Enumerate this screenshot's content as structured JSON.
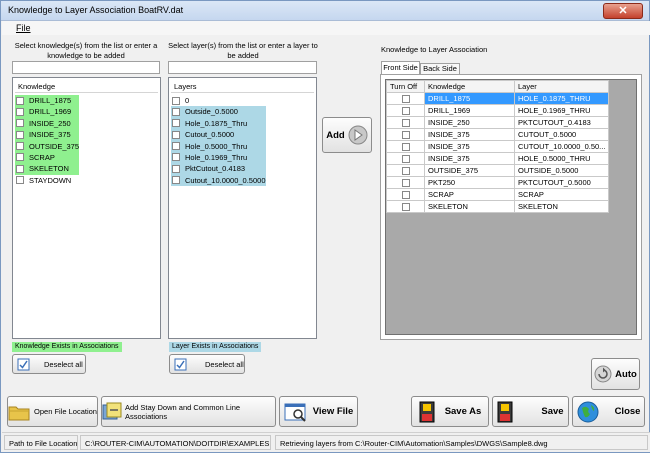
{
  "window": {
    "title": "Knowledge to Layer Association BoatRV.dat"
  },
  "menu": {
    "file": "File"
  },
  "knowledge": {
    "instruction": "Select knowledge(s) from the list or enter a knowledge to be added",
    "input_value": "",
    "header": "Knowledge",
    "items": [
      {
        "label": "DRILL_1875",
        "in_assoc": true
      },
      {
        "label": "DRILL_1969",
        "in_assoc": true
      },
      {
        "label": "INSIDE_250",
        "in_assoc": true
      },
      {
        "label": "INSIDE_375",
        "in_assoc": true
      },
      {
        "label": "OUTSIDE_375",
        "in_assoc": true
      },
      {
        "label": "SCRAP",
        "in_assoc": true
      },
      {
        "label": "SKELETON",
        "in_assoc": true
      },
      {
        "label": "STAYDOWN",
        "in_assoc": false
      }
    ],
    "legend": "Knowledge Exists in Associations",
    "deselect": "Deselect all"
  },
  "layers": {
    "instruction": "Select layer(s) from the list or enter a layer to be added",
    "input_value": "",
    "header": "Layers",
    "items": [
      {
        "label": "0",
        "in_assoc": false
      },
      {
        "label": "Outside_0.5000",
        "in_assoc": true
      },
      {
        "label": "Hole_0.1875_Thru",
        "in_assoc": true
      },
      {
        "label": "Cutout_0.5000",
        "in_assoc": true
      },
      {
        "label": "Hole_0.5000_Thru",
        "in_assoc": true
      },
      {
        "label": "Hole_0.1969_Thru",
        "in_assoc": true
      },
      {
        "label": "PktCutout_0.4183",
        "in_assoc": true
      },
      {
        "label": "Cutout_10.0000_0.5000",
        "in_assoc": true
      }
    ],
    "legend": "Layer Exists in Associations",
    "deselect": "Deselect all"
  },
  "add_button": "Add",
  "association": {
    "group_label": "Knowledge to Layer Association",
    "tabs": [
      "Front Side",
      "Back Side"
    ],
    "active_tab": 0,
    "columns": [
      "Turn Off",
      "Knowledge",
      "Layer"
    ],
    "rows": [
      {
        "knowledge": "DRILL_1875",
        "layer": "HOLE_0.1875_THRU",
        "selected": true
      },
      {
        "knowledge": "DRILL_1969",
        "layer": "HOLE_0.1969_THRU",
        "selected": false
      },
      {
        "knowledge": "INSIDE_250",
        "layer": "PKTCUTOUT_0.4183",
        "selected": false
      },
      {
        "knowledge": "INSIDE_375",
        "layer": "CUTOUT_0.5000",
        "selected": false
      },
      {
        "knowledge": "INSIDE_375",
        "layer": "CUTOUT_10.0000_0.50...",
        "selected": false
      },
      {
        "knowledge": "INSIDE_375",
        "layer": "HOLE_0.5000_THRU",
        "selected": false
      },
      {
        "knowledge": "OUTSIDE_375",
        "layer": "OUTSIDE_0.5000",
        "selected": false
      },
      {
        "knowledge": "PKT250",
        "layer": "PKTCUTOUT_0.5000",
        "selected": false
      },
      {
        "knowledge": "SCRAP",
        "layer": "SCRAP",
        "selected": false
      },
      {
        "knowledge": "SKELETON",
        "layer": "SKELETON",
        "selected": false
      }
    ],
    "auto_button": "Auto"
  },
  "toolbar": {
    "open_file_location": "Open File Location",
    "add_stay_down": "Add Stay Down and Common Line Associations",
    "view_file": "View File",
    "save_as": "Save As",
    "save": "Save",
    "close": "Close"
  },
  "status": {
    "path_label": "Path to File Location",
    "path_value": "C:\\ROUTER-CIM\\AUTOMATION\\DOITDIR\\EXAMPLES",
    "message": "Retrieving layers from C:\\Router-CIM\\Automation\\Samples\\DWGS\\Sample8.dwg"
  },
  "colors": {
    "knowledge_highlight": "#8ff08f",
    "layer_highlight": "#add8e6",
    "selection": "#3399ff"
  }
}
